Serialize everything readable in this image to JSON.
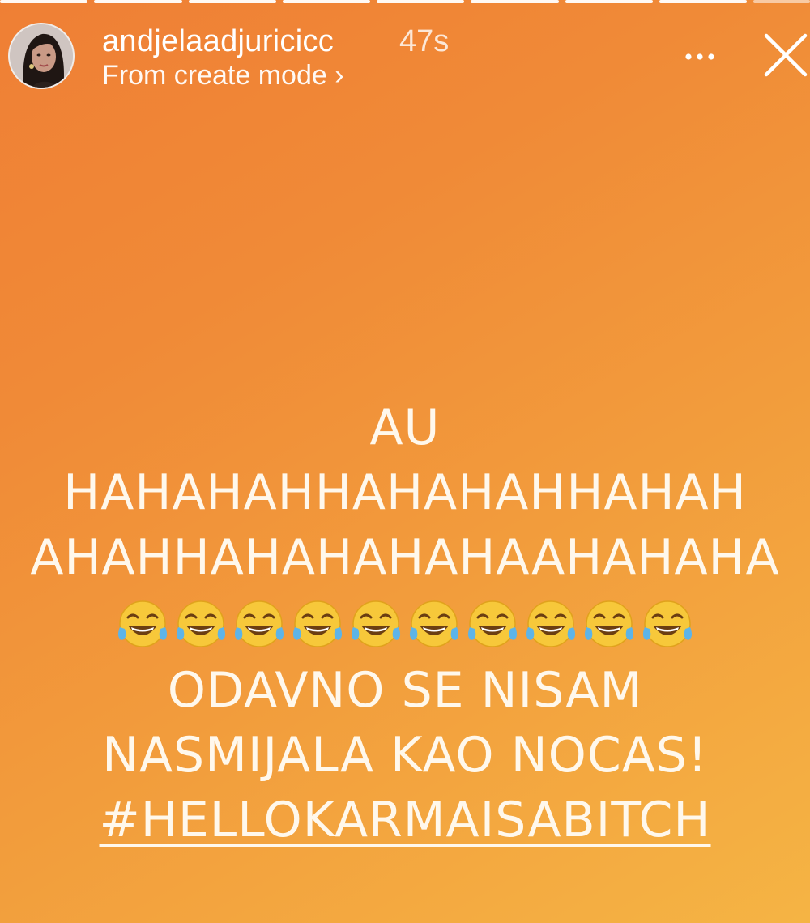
{
  "story": {
    "background_colors": [
      "#ef7f35",
      "#f5b444"
    ],
    "progress_segments": 9
  },
  "header": {
    "username": "andjelaadjuricicc",
    "time_ago": "47s",
    "subtitle": "From create mode ›",
    "avatar_icon": "profile-photo",
    "more_icon": "more-dots-icon",
    "close_icon": "close-icon"
  },
  "caption": {
    "line1": "AU",
    "line2": "HAHAHAHHAHAHAHHAHAH",
    "line3": "AHAHHAHAHAHAHAAHAHAHA",
    "emoji": "😂",
    "emoji_count": 10,
    "line5": "ODAVNO SE NISAM",
    "line6": "NASMIJALA KAO NOCAS!",
    "hashtag": "#HELLOKARMAISABITCH"
  }
}
